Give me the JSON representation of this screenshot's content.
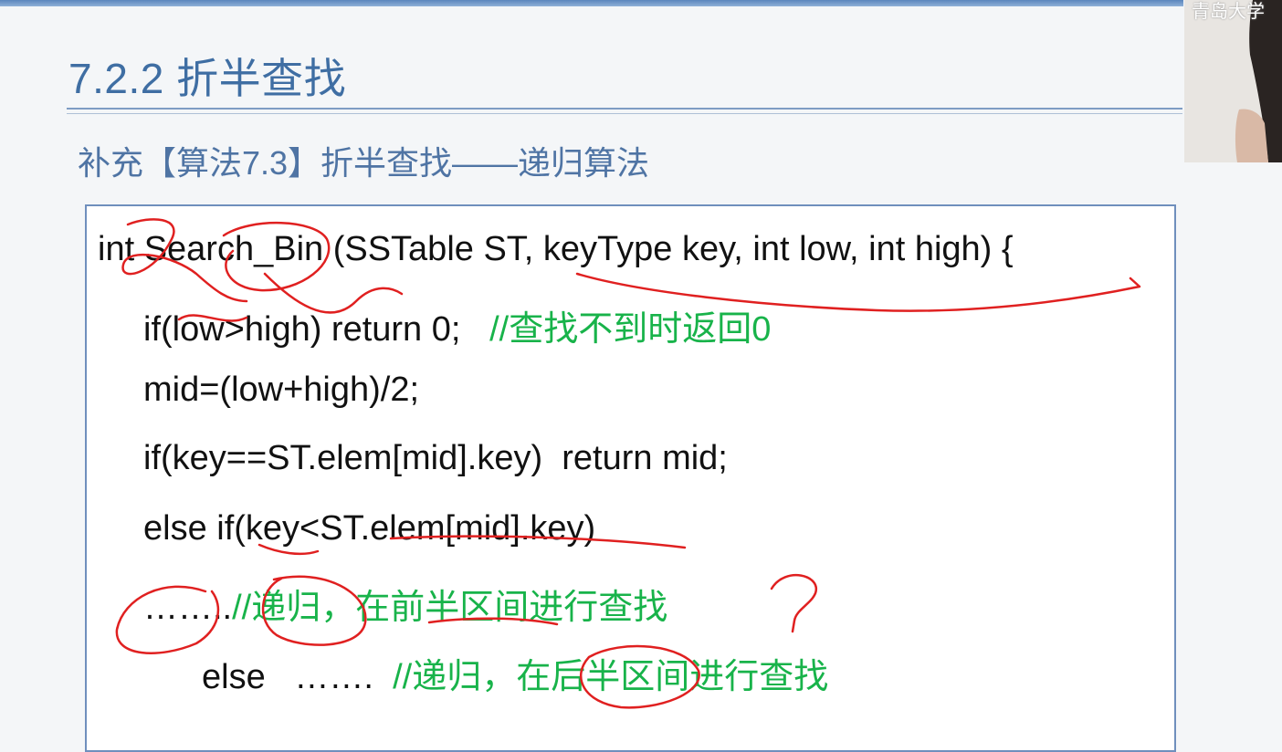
{
  "slide": {
    "title": "7.2.2 折半查找",
    "subtitle": "补充【算法7.3】折半查找——递归算法"
  },
  "code": {
    "line1": "int Search_Bin (SSTable ST, keyType key, int low, int high) {",
    "line2_code": "if(low>high) return 0;",
    "line2_comment": "//查找不到时返回0",
    "line3": "mid=(low+high)/2;",
    "line4": "if(key==ST.elem[mid].key)  return mid;",
    "line5": "else if(key<ST.elem[mid].key)",
    "line6_code": "……..",
    "line6_comment": "//递归，在前半区间进行查找",
    "line7_code": "else   …….",
    "line7_comment": "//递归，在后半区间进行查找"
  },
  "webcam": {
    "label": "青岛大学"
  },
  "colors": {
    "title": "#3f6ea3",
    "comment": "#18b34a",
    "ink": "#e02020",
    "border": "#6f8fbd"
  }
}
